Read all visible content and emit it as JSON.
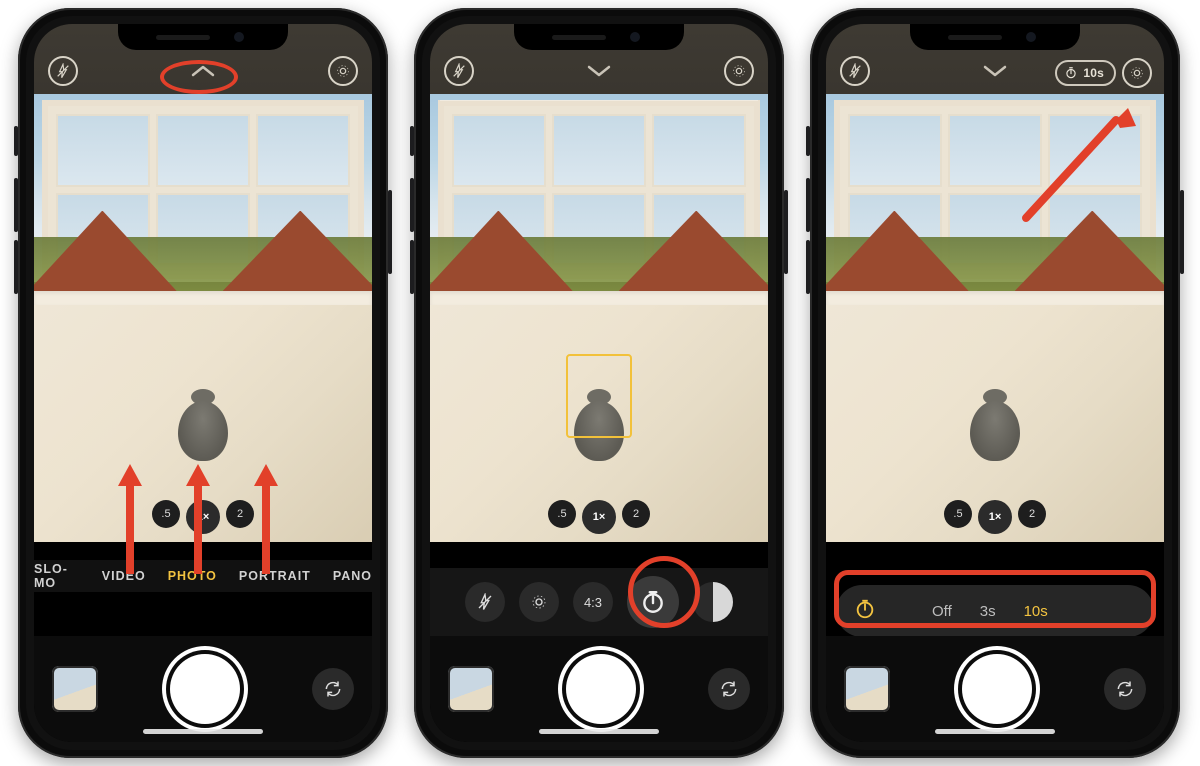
{
  "zoom": {
    "opts": [
      ".5",
      "1×",
      "2"
    ],
    "selected_index": 1
  },
  "modes": {
    "opts": [
      "SLO-MO",
      "VIDEO",
      "PHOTO",
      "PORTRAIT",
      "PANO"
    ],
    "selected_index": 2
  },
  "aspect_label": "4:3",
  "timer": {
    "opts": [
      "Off",
      "3s",
      "10s"
    ],
    "selected_index": 2,
    "badge": "10s"
  },
  "colors": {
    "accent": "#f3c340",
    "annotate": "#e2402a"
  }
}
